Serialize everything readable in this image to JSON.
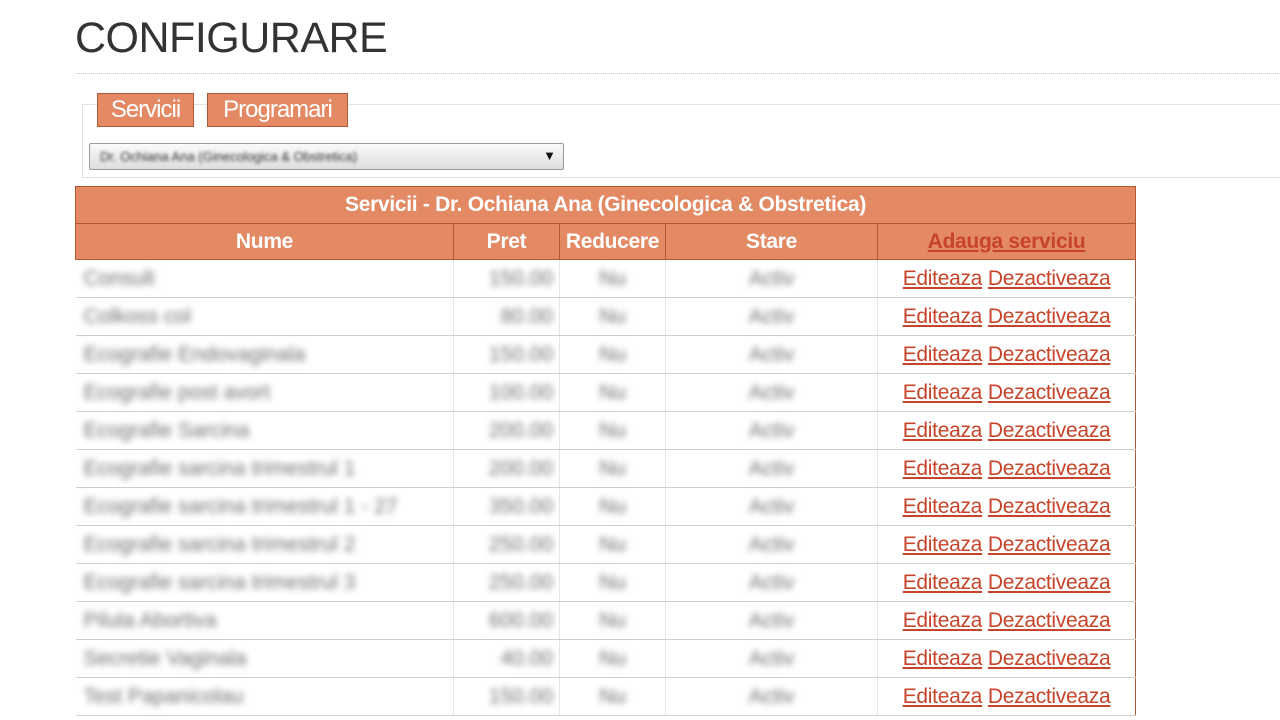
{
  "page": {
    "title": "CONFIGURARE"
  },
  "tabs": [
    {
      "label": "Servicii"
    },
    {
      "label": "Programari"
    }
  ],
  "doctor_select": {
    "selected": "Dr. Ochiana Ana (Ginecologica & Obstretica)"
  },
  "table": {
    "caption": "Servicii - Dr. Ochiana Ana (Ginecologica & Obstretica)",
    "headers": {
      "name": "Nume",
      "price": "Pret",
      "discount": "Reducere",
      "status": "Stare",
      "add": "Adauga serviciu"
    },
    "action_labels": {
      "edit": "Editeaza",
      "deactivate": "Dezactiveaza"
    },
    "rows": [
      {
        "name": "Consult",
        "price": "150.00",
        "discount": "Nu",
        "status": "Activ"
      },
      {
        "name": "Colkoss col",
        "price": "80.00",
        "discount": "Nu",
        "status": "Activ"
      },
      {
        "name": "Ecografie Endovaginala",
        "price": "150.00",
        "discount": "Nu",
        "status": "Activ"
      },
      {
        "name": "Ecografie post avort",
        "price": "100.00",
        "discount": "Nu",
        "status": "Activ"
      },
      {
        "name": "Ecografie Sarcina",
        "price": "200.00",
        "discount": "Nu",
        "status": "Activ"
      },
      {
        "name": "Ecografie sarcina trimestrul 1",
        "price": "200.00",
        "discount": "Nu",
        "status": "Activ"
      },
      {
        "name": "Ecografie sarcina trimestrul 1 - 27",
        "price": "350.00",
        "discount": "Nu",
        "status": "Activ"
      },
      {
        "name": "Ecografie sarcina trimestrul 2",
        "price": "250.00",
        "discount": "Nu",
        "status": "Activ"
      },
      {
        "name": "Ecografie sarcina trimestrul 3",
        "price": "250.00",
        "discount": "Nu",
        "status": "Activ"
      },
      {
        "name": "Pilula Abortiva",
        "price": "600.00",
        "discount": "Nu",
        "status": "Activ"
      },
      {
        "name": "Secretie Vaginala",
        "price": "40.00",
        "discount": "Nu",
        "status": "Activ"
      },
      {
        "name": "Test Papanicolau",
        "price": "150.00",
        "discount": "Nu",
        "status": "Activ"
      }
    ]
  },
  "colors": {
    "accent": "#e38964",
    "accent_border": "#b2583a",
    "link": "#c7442a"
  }
}
